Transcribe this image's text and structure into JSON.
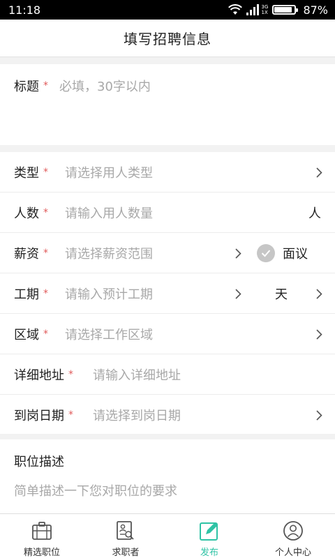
{
  "status_bar": {
    "time": "11:18",
    "network_top": "3G",
    "network_bottom": "1X",
    "battery": "87%",
    "battery_level": 0.87
  },
  "header": {
    "title": "填写招聘信息"
  },
  "title_field": {
    "label": "标题",
    "required_mark": "*",
    "placeholder": "必填，30字以内"
  },
  "form": {
    "type": {
      "label": "类型",
      "required_mark": "*",
      "placeholder": "请选择用人类型"
    },
    "count": {
      "label": "人数",
      "required_mark": "*",
      "placeholder": "请输入用人数量",
      "unit": "人"
    },
    "salary": {
      "label": "薪资",
      "required_mark": "*",
      "placeholder": "请选择薪资范围",
      "negotiable_label": "面议"
    },
    "duration": {
      "label": "工期",
      "required_mark": "*",
      "placeholder": "请输入预计工期",
      "unit": "天"
    },
    "area": {
      "label": "区域",
      "required_mark": "*",
      "placeholder": "请选择工作区域"
    },
    "address": {
      "label": "详细地址",
      "required_mark": "*",
      "placeholder": "请输入详细地址"
    },
    "arrival_date": {
      "label": "到岗日期",
      "required_mark": "*",
      "placeholder": "请选择到岗日期"
    }
  },
  "description": {
    "label": "职位描述",
    "placeholder": "简单描述一下您对职位的要求"
  },
  "tabbar": {
    "tabs": [
      {
        "label": "精选职位",
        "icon": "briefcase-icon"
      },
      {
        "label": "求职者",
        "icon": "resume-search-icon"
      },
      {
        "label": "发布",
        "icon": "edit-icon",
        "active": true
      },
      {
        "label": "个人中心",
        "icon": "user-icon"
      }
    ]
  },
  "colors": {
    "accent": "#2fc3a5",
    "required": "#e05a5a",
    "placeholder": "#a8a8a8"
  }
}
